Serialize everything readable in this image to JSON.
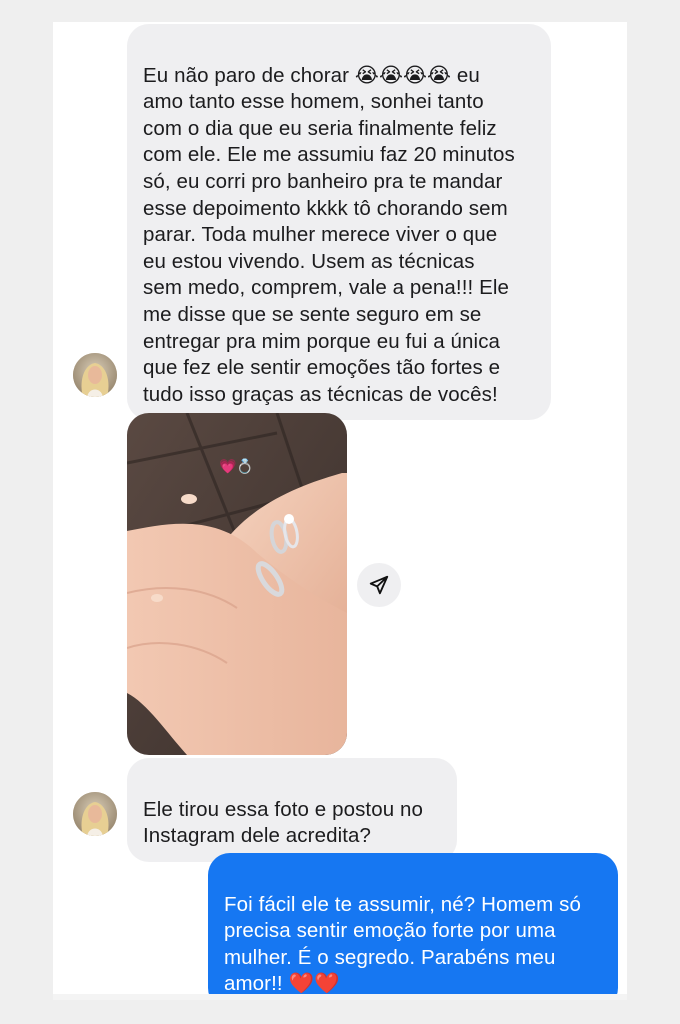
{
  "messages": {
    "first": {
      "text": "Eu não paro de chorar 😭😭😭😭 eu\namo tanto esse homem, sonhei tanto\ncom o dia que eu seria finalmente feliz\ncom ele. Ele me assumiu faz 20 minutos\nsó, eu corri pro banheiro pra te mandar\nesse depoimento kkkk tô chorando sem\nparar. Toda mulher merece viver o que\neu estou vivendo. Usem as técnicas\nsem medo, comprem, vale a pena!!! Ele\nme disse que se sente seguro em se\nentregar pra mim porque eu fui a única\nque fez ele sentir emoções tão fortes e\ntudo isso graças as técnicas de vocês!"
    },
    "second": {
      "text": "Ele tirou essa foto e postou no\nInstagram dele acredita?"
    },
    "reply": {
      "text": "Foi fácil ele te assumir, né? Homem só\nprecisa sentir emoção forte por uma\nmulher. É o segredo. Parabéns meu\namor!! ❤️❤️"
    }
  },
  "photo": {
    "overlay_emoji": "💗💍"
  },
  "icons": {
    "share": "paper-plane-icon",
    "avatar": "user-avatar"
  },
  "colors": {
    "incoming_bubble": "#efeff1",
    "outgoing_bubble": "#1677f2",
    "background": "#ffffff"
  }
}
